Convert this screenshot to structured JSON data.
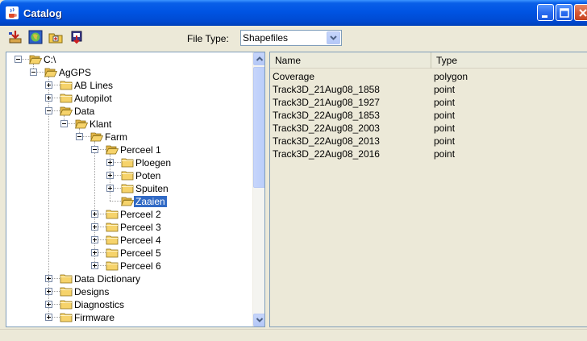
{
  "window": {
    "title": "Catalog"
  },
  "toolbar": {
    "tools": [
      "import-icon",
      "globe-icon",
      "new-folder-icon",
      "delete-icon"
    ],
    "file_type_label": "File Type:",
    "file_type_value": "Shapefiles"
  },
  "tree": {
    "nodes": [
      {
        "label": "C:\\",
        "expanded": true
      },
      {
        "label": "AgGPS",
        "expanded": true
      },
      {
        "label": "AB Lines",
        "expanded": false
      },
      {
        "label": "Autopilot",
        "expanded": false
      },
      {
        "label": "Data",
        "expanded": true
      },
      {
        "label": "Klant",
        "expanded": true
      },
      {
        "label": "Farm",
        "expanded": true
      },
      {
        "label": "Perceel 1",
        "expanded": true
      },
      {
        "label": "Ploegen",
        "expanded": false
      },
      {
        "label": "Poten",
        "expanded": false
      },
      {
        "label": "Spuiten",
        "expanded": false
      },
      {
        "label": "Zaaien",
        "selected": true
      },
      {
        "label": "Perceel 2",
        "expanded": false
      },
      {
        "label": "Perceel 3",
        "expanded": false
      },
      {
        "label": "Perceel 4",
        "expanded": false
      },
      {
        "label": "Perceel 5",
        "expanded": false
      },
      {
        "label": "Perceel 6",
        "expanded": false
      },
      {
        "label": "Data Dictionary",
        "expanded": false
      },
      {
        "label": "Designs",
        "expanded": false
      },
      {
        "label": "Diagnostics",
        "expanded": false
      },
      {
        "label": "Firmware",
        "expanded": false
      }
    ]
  },
  "list": {
    "columns": [
      "Name",
      "Type"
    ],
    "rows": [
      {
        "name": "Coverage",
        "type": "polygon"
      },
      {
        "name": "Track3D_21Aug08_1858",
        "type": "point"
      },
      {
        "name": "Track3D_21Aug08_1927",
        "type": "point"
      },
      {
        "name": "Track3D_22Aug08_1853",
        "type": "point"
      },
      {
        "name": "Track3D_22Aug08_2003",
        "type": "point"
      },
      {
        "name": "Track3D_22Aug08_2013",
        "type": "point"
      },
      {
        "name": "Track3D_22Aug08_2016",
        "type": "point"
      }
    ]
  },
  "colors": {
    "title_bar": "#0054e3",
    "selection": "#316ac5",
    "folder": "#f6d36b"
  }
}
